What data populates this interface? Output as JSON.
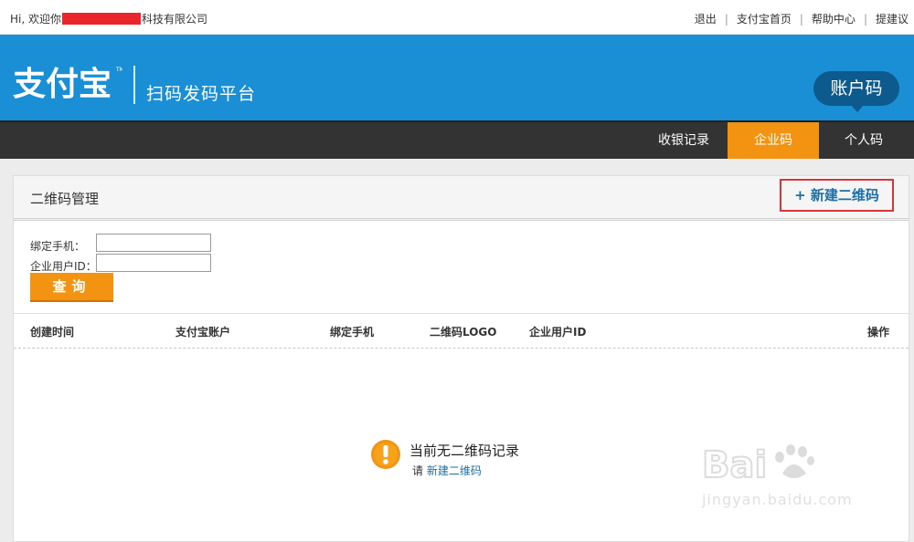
{
  "topbar": {
    "greeting_prefix": "Hi, 欢迎你",
    "greeting_suffix": "科技有限公司",
    "links": [
      "退出",
      "支付宝首页",
      "帮助中心",
      "提建议"
    ]
  },
  "header": {
    "logo_text": "支付宝",
    "platform_name": "扫码发码平台",
    "account_badge": "账户码"
  },
  "nav": {
    "tabs": [
      {
        "label": "收银记录",
        "active": false
      },
      {
        "label": "企业码",
        "active": true
      },
      {
        "label": "个人码",
        "active": false
      }
    ]
  },
  "panel": {
    "title": "二维码管理",
    "new_button": "+ 新建二维码"
  },
  "form": {
    "phone_label": "绑定手机：",
    "phone_value": "",
    "userid_label": "企业用户ID：",
    "userid_value": "",
    "query_button": "查询"
  },
  "table": {
    "columns": [
      "创建时间",
      "支付宝账户",
      "绑定手机",
      "二维码LOGO",
      "企业用户ID",
      "操作"
    ],
    "rows": []
  },
  "empty_state": {
    "title": "当前无二维码记录",
    "prompt_prefix": "请",
    "prompt_link": "新建二维码"
  },
  "watermark": {
    "text": "jingyan.baidu.com"
  },
  "colors": {
    "header_blue": "#1a8fd6",
    "nav_dark": "#333333",
    "active_tab": "#f39312",
    "link_blue": "#1a6fa8",
    "highlight_red": "#d6353b"
  }
}
